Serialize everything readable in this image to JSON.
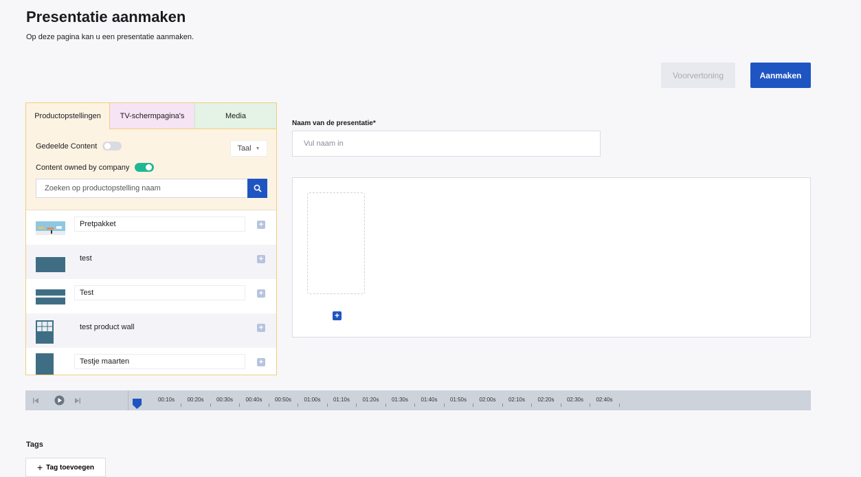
{
  "header": {
    "title": "Presentatie aanmaken",
    "subtitle": "Op deze pagina kan u een presentatie aanmaken."
  },
  "actions": {
    "preview_label": "Voorvertoning",
    "create_label": "Aanmaken"
  },
  "left_panel": {
    "tabs": [
      "Productopstellingen",
      "TV-schermpagina's",
      "Media"
    ],
    "active_tab": "Productopstellingen",
    "shared_content_label": "Gedeelde Content",
    "shared_content_on": false,
    "owned_content_label": "Content owned by company",
    "owned_content_on": true,
    "language_label": "Taal",
    "search_placeholder": "Zoeken op productopstelling naam",
    "items": [
      {
        "name": "Pretpakket"
      },
      {
        "name": "test"
      },
      {
        "name": "Test"
      },
      {
        "name": "test product wall"
      },
      {
        "name": "Testje maarten"
      }
    ]
  },
  "form": {
    "name_label": "Naam van de presentatie*",
    "name_placeholder": "Vul naam in"
  },
  "timeline": {
    "labels": [
      "00:10s",
      "00:20s",
      "00:30s",
      "00:40s",
      "00:50s",
      "01:00s",
      "01:10s",
      "01:20s",
      "01:30s",
      "01:40s",
      "01:50s",
      "02:00s",
      "02:10s",
      "02:20s",
      "02:30s",
      "02:40s"
    ]
  },
  "tags": {
    "label": "Tags",
    "add_label": "Tag toevoegen"
  },
  "colors": {
    "accent": "#1f55c2",
    "toggle_on": "#1fb894",
    "panel_border": "#f1cd7c"
  }
}
